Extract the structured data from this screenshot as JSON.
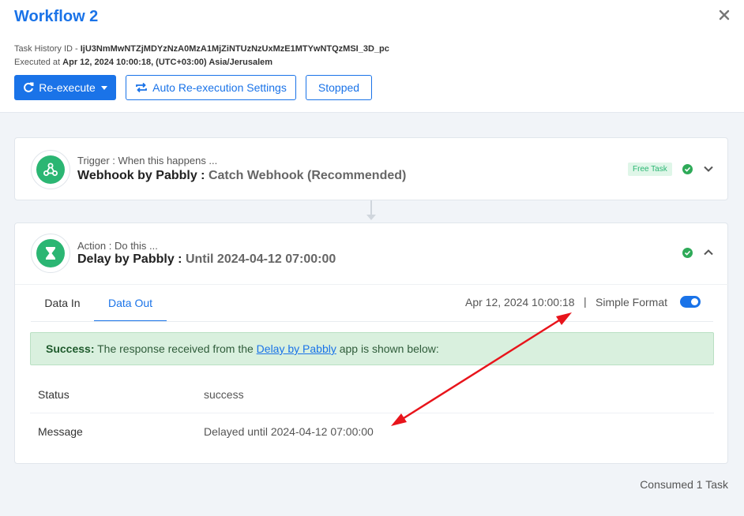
{
  "header": {
    "title": "Workflow 2",
    "task_history_label": "Task History ID - ",
    "task_history_id": "IjU3NmMwNTZjMDYzNzA0MzA1MjZiNTUzNzUxMzE1MTYwNTQzMSI_3D_pc",
    "executed_label": "Executed at ",
    "executed_value": "Apr 12, 2024 10:00:18, (UTC+03:00) Asia/Jerusalem",
    "reexecute_label": "Re-execute",
    "auto_label": "Auto Re-execution Settings",
    "stopped_label": "Stopped"
  },
  "trigger": {
    "sub": "Trigger : When this happens ...",
    "app": "Webhook by Pabbly : ",
    "event": "Catch Webhook (Recommended)",
    "badge": "Free Task"
  },
  "action": {
    "sub": "Action : Do this ...",
    "app": "Delay by Pabbly : ",
    "event": "Until 2024-04-12 07:00:00",
    "tab_in": "Data In",
    "tab_out": "Data Out",
    "exec_time": "Apr 12, 2024 10:00:18",
    "separator": "|",
    "simple_format": "Simple Format",
    "success_bold": "Success:",
    "success_pre": " The response received from the ",
    "success_link": "Delay by Pabbly",
    "success_post": " app is shown below:",
    "rows": [
      {
        "label": "Status",
        "value": "success"
      },
      {
        "label": "Message",
        "value": "Delayed until 2024-04-12 07:00:00"
      }
    ]
  },
  "footer": {
    "consumed": "Consumed 1 Task"
  },
  "colors": {
    "accent": "#1a73e8",
    "app_green": "#2bb673",
    "annotation_red": "#e8141b"
  }
}
